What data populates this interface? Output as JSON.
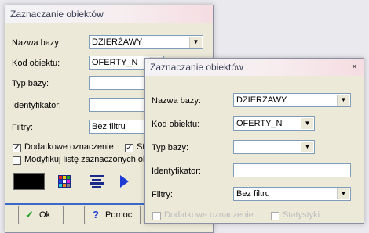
{
  "back_dialog": {
    "title": "Zaznaczanie obiektów",
    "fields": {
      "nazwa_bazy": {
        "label": "Nazwa bazy:",
        "value": "DZIERŻAWY"
      },
      "kod_obiektu": {
        "label": "Kod obiektu:",
        "value": "OFERTY_N"
      },
      "typ_bazy": {
        "label": "Typ bazy:",
        "value": ""
      },
      "identyfikator": {
        "label": "Identyfikator:",
        "value": ""
      },
      "filtry": {
        "label": "Filtry:",
        "value": "Bez filtru"
      }
    },
    "checkboxes": {
      "dodatkowe": {
        "label": "Dodatkowe oznaczenie",
        "checked": true
      },
      "st_partial": {
        "label": "St",
        "checked": true
      },
      "modyfikuj": {
        "label": "Modyfikuj listę zaznaczonych obi",
        "checked": false
      }
    },
    "buttons": {
      "ok": "Ok",
      "pomoc": "Pomoc"
    }
  },
  "front_dialog": {
    "title": "Zaznaczanie obiektów",
    "close_label": "×",
    "fields": {
      "nazwa_bazy": {
        "label": "Nazwa bazy:",
        "value": "DZIERŻAWY"
      },
      "kod_obiektu": {
        "label": "Kod obiektu:",
        "value": "OFERTY_N"
      },
      "typ_bazy": {
        "label": "Typ bazy:",
        "value": ""
      },
      "identyfikator": {
        "label": "Identyfikator:",
        "value": ""
      },
      "filtry": {
        "label": "Filtry:",
        "value": "Bez filtru"
      }
    },
    "checkboxes": {
      "partial_left": {
        "label": "Dodatkowe oznaczenie",
        "checked": false
      },
      "partial_right": {
        "label": "Statystyki",
        "checked": false
      }
    }
  },
  "icons": {
    "black_box": "black-color-swatch-icon",
    "palette": "color-palette-icon",
    "layers": "layers-icon",
    "play": "play-arrow-icon"
  },
  "colors": {
    "accent_blue": "#1a4fd6",
    "arrow_blue": "#1f3bd6"
  }
}
